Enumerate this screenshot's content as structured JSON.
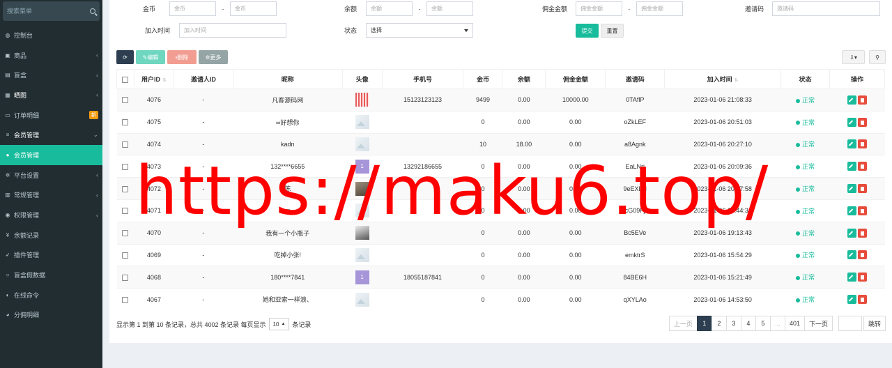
{
  "sidebar": {
    "search_placeholder": "搜索菜单",
    "items": [
      {
        "icon": "dashboard-icon",
        "glyph": "◍",
        "label": "控制台",
        "chev": "",
        "badge": "",
        "state": ""
      },
      {
        "icon": "shopping-bag-icon",
        "glyph": "▣",
        "label": "商品",
        "chev": "‹",
        "badge": "",
        "state": ""
      },
      {
        "icon": "box-icon",
        "glyph": "▤",
        "label": "盲盒",
        "chev": "‹",
        "badge": "",
        "state": ""
      },
      {
        "icon": "image-icon",
        "glyph": "▦",
        "label": "晒图",
        "chev": "‹",
        "badge": "",
        "state": "open"
      },
      {
        "icon": "cart-icon",
        "glyph": "▭",
        "label": "订单明细",
        "chev": "",
        "badge": "新",
        "state": ""
      },
      {
        "icon": "list-icon",
        "glyph": "≡",
        "label": "会员管理",
        "chev": "⌄",
        "badge": "",
        "state": "open"
      },
      {
        "icon": "user-icon",
        "glyph": "●",
        "label": "会员管理",
        "chev": "",
        "badge": "",
        "state": "active"
      },
      {
        "icon": "gears-icon",
        "glyph": "✲",
        "label": "平台设置",
        "chev": "‹",
        "badge": "",
        "state": ""
      },
      {
        "icon": "list-alt-icon",
        "glyph": "▥",
        "label": "常规管理",
        "chev": "‹",
        "badge": "",
        "state": ""
      },
      {
        "icon": "group-icon",
        "glyph": "◉",
        "label": "权限管理",
        "chev": "‹",
        "badge": "",
        "state": ""
      },
      {
        "icon": "yen-icon",
        "glyph": "¥",
        "label": "余额记录",
        "chev": "",
        "badge": "",
        "state": ""
      },
      {
        "icon": "rocket-icon",
        "glyph": "➶",
        "label": "插件管理",
        "chev": "",
        "badge": "",
        "state": ""
      },
      {
        "icon": "circle-icon",
        "glyph": "○",
        "label": "盲盒假数据",
        "chev": "",
        "badge": "",
        "state": ""
      },
      {
        "icon": "adjust-icon",
        "glyph": "◐",
        "label": "在线命令",
        "chev": "",
        "badge": "",
        "state": ""
      },
      {
        "icon": "users-icon",
        "glyph": "◕",
        "label": "分佣明细",
        "chev": "",
        "badge": "",
        "state": ""
      }
    ]
  },
  "filters": {
    "gold_label": "金币",
    "gold_ph": "金币",
    "balance_label": "余额",
    "balance_ph": "余额",
    "commission_label": "佣金金额",
    "commission_ph": "佣金金额",
    "invite_label": "邀请码",
    "invite_ph": "邀请码",
    "jointime_label": "加入时间",
    "jointime_ph": "加入时间",
    "status_label": "状态",
    "status_value": "选择",
    "dash": "-",
    "submit": "提交",
    "reset": "重置"
  },
  "toolbar": {
    "edit": "编辑",
    "delete": "删除",
    "more": "更多"
  },
  "table": {
    "headers": [
      "用户ID",
      "邀请人ID",
      "昵称",
      "头像",
      "手机号",
      "金币",
      "余额",
      "佣金金额",
      "邀请码",
      "加入时间",
      "状态",
      "操作"
    ],
    "rows": [
      {
        "id": "4076",
        "inviter": "-",
        "nick": "凡客源码网",
        "avatar": "red",
        "avatar_text": "",
        "phone": "15123123123",
        "gold": "9499",
        "balance": "0.00",
        "commission": "10000.00",
        "code": "0TAflP",
        "time": "2023-01-06 21:08:33",
        "status": "正常"
      },
      {
        "id": "4075",
        "inviter": "-",
        "nick": "∞好想你",
        "avatar": "img",
        "avatar_text": "",
        "phone": "",
        "gold": "0",
        "balance": "0.00",
        "commission": "0.00",
        "code": "oZkLEF",
        "time": "2023-01-06 20:51:03",
        "status": "正常"
      },
      {
        "id": "4074",
        "inviter": "-",
        "nick": "kadn",
        "avatar": "img",
        "avatar_text": "",
        "phone": "",
        "gold": "10",
        "balance": "18.00",
        "commission": "0.00",
        "code": "a8Agnk",
        "time": "2023-01-06 20:27:10",
        "status": "正常"
      },
      {
        "id": "4073",
        "inviter": "-",
        "nick": "132****6655",
        "avatar": "num",
        "avatar_text": "1",
        "phone": "13292186655",
        "gold": "0",
        "balance": "0.00",
        "commission": "0.00",
        "code": "EaLNrj",
        "time": "2023-01-06 20:09:36",
        "status": "正常"
      },
      {
        "id": "4072",
        "inviter": "-",
        "nick": "陈",
        "avatar": "photo",
        "avatar_text": "",
        "phone": "",
        "gold": "0",
        "balance": "0.00",
        "commission": "0.00",
        "code": "9eEXLN",
        "time": "2023-01-06 20:07:58",
        "status": "正常"
      },
      {
        "id": "4071",
        "inviter": "-",
        "nick": "m",
        "avatar": "img",
        "avatar_text": "",
        "phone": "",
        "gold": "0",
        "balance": "0.00",
        "commission": "0.00",
        "code": "cG09Fj",
        "time": "2023-01-06 19:44:31",
        "status": "正常"
      },
      {
        "id": "4070",
        "inviter": "-",
        "nick": "我有一个小瓶子",
        "avatar": "photo2",
        "avatar_text": "",
        "phone": "",
        "gold": "0",
        "balance": "0.00",
        "commission": "0.00",
        "code": "Bc5EVe",
        "time": "2023-01-06 19:13:43",
        "status": "正常"
      },
      {
        "id": "4069",
        "inviter": "-",
        "nick": "吃掉小张!",
        "avatar": "img",
        "avatar_text": "",
        "phone": "",
        "gold": "0",
        "balance": "0.00",
        "commission": "0.00",
        "code": "emktrS",
        "time": "2023-01-06 15:54:29",
        "status": "正常"
      },
      {
        "id": "4068",
        "inviter": "-",
        "nick": "180****7841",
        "avatar": "num",
        "avatar_text": "1",
        "phone": "18055187841",
        "gold": "0",
        "balance": "0.00",
        "commission": "0.00",
        "code": "84BE6H",
        "time": "2023-01-06 15:21:49",
        "status": "正常"
      },
      {
        "id": "4067",
        "inviter": "-",
        "nick": "她和亚索一样浪、",
        "avatar": "img",
        "avatar_text": "",
        "phone": "",
        "gold": "0",
        "balance": "0.00",
        "commission": "0.00",
        "code": "qXYLAo",
        "time": "2023-01-06 14:53:50",
        "status": "正常"
      }
    ]
  },
  "footer": {
    "info_prefix": "显示第 1 到第 10 条记录，总共 4002 条记录 每页显示",
    "page_size": "10",
    "info_suffix": "条记录"
  },
  "pagination": {
    "prev": "上一页",
    "pages": [
      "1",
      "2",
      "3",
      "4",
      "5",
      "...",
      "401"
    ],
    "next": "下一页",
    "go": "跳转"
  },
  "watermark": "https://maku6.top/",
  "colors": {
    "accent": "#18bc9c",
    "sidebar": "#222d32",
    "danger": "#e74c3c",
    "dark": "#2c3e50"
  }
}
